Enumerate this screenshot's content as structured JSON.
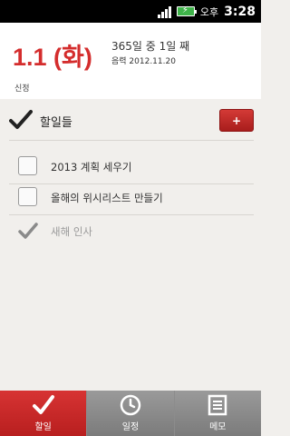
{
  "status_bar": {
    "ampm": "오후",
    "time": "3:28"
  },
  "header": {
    "date": "1.1 (화)",
    "day_count": "365일 중 1일 째",
    "lunar": "음력 2012.11.20",
    "sub_label": "신정"
  },
  "todo": {
    "title": "할일들",
    "add_label": "+",
    "items": [
      {
        "text": "2013 계획 세우기",
        "done": false
      },
      {
        "text": "올해의 위시리스트 만들기",
        "done": false
      },
      {
        "text": "새해 인사",
        "done": true
      }
    ]
  },
  "nav": {
    "items": [
      {
        "label": "할일",
        "icon": "checkmark-icon",
        "active": true
      },
      {
        "label": "일정",
        "icon": "clock-icon",
        "active": false
      },
      {
        "label": "메모",
        "icon": "memo-icon",
        "active": false
      }
    ]
  },
  "colors": {
    "accent": "#d42d2d",
    "background": "#f1efec",
    "nav_inactive": "#888888"
  }
}
